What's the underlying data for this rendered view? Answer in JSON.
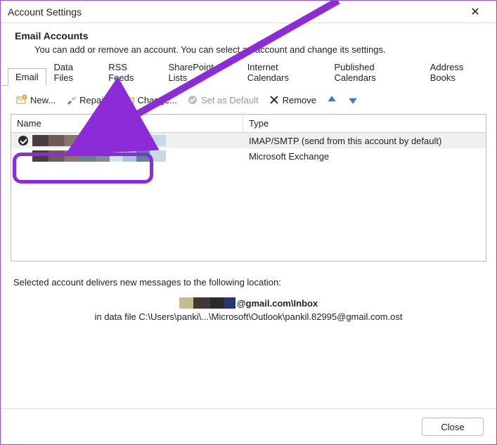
{
  "window": {
    "title": "Account Settings",
    "close_glyph": "✕"
  },
  "header": {
    "title": "Email Accounts",
    "subtitle": "You can add or remove an account. You can select an account and change its settings."
  },
  "tabs": [
    {
      "label": "Email",
      "active": true
    },
    {
      "label": "Data Files"
    },
    {
      "label": "RSS Feeds"
    },
    {
      "label": "SharePoint Lists"
    },
    {
      "label": "Internet Calendars"
    },
    {
      "label": "Published Calendars"
    },
    {
      "label": "Address Books"
    }
  ],
  "toolbar": {
    "new_label": "New...",
    "repair_label": "Repair...",
    "change_label": "Change...",
    "set_default_label": "Set as Default",
    "remove_label": "Remove"
  },
  "list": {
    "columns": {
      "name": "Name",
      "type": "Type"
    },
    "rows": [
      {
        "name_redacted": true,
        "is_default": true,
        "selected": true,
        "type": "IMAP/SMTP (send from this account by default)"
      },
      {
        "name_redacted": true,
        "is_default": false,
        "selected": false,
        "type": "Microsoft Exchange"
      }
    ]
  },
  "info": {
    "line1": "Selected account delivers new messages to the following location:",
    "mailbox_suffix": "@gmail.com\\Inbox",
    "data_file_line": "in data file C:\\Users\\panki\\...\\Microsoft\\Outlook\\pankil.82995@gmail.com.ost"
  },
  "footer": {
    "close_label": "Close"
  }
}
